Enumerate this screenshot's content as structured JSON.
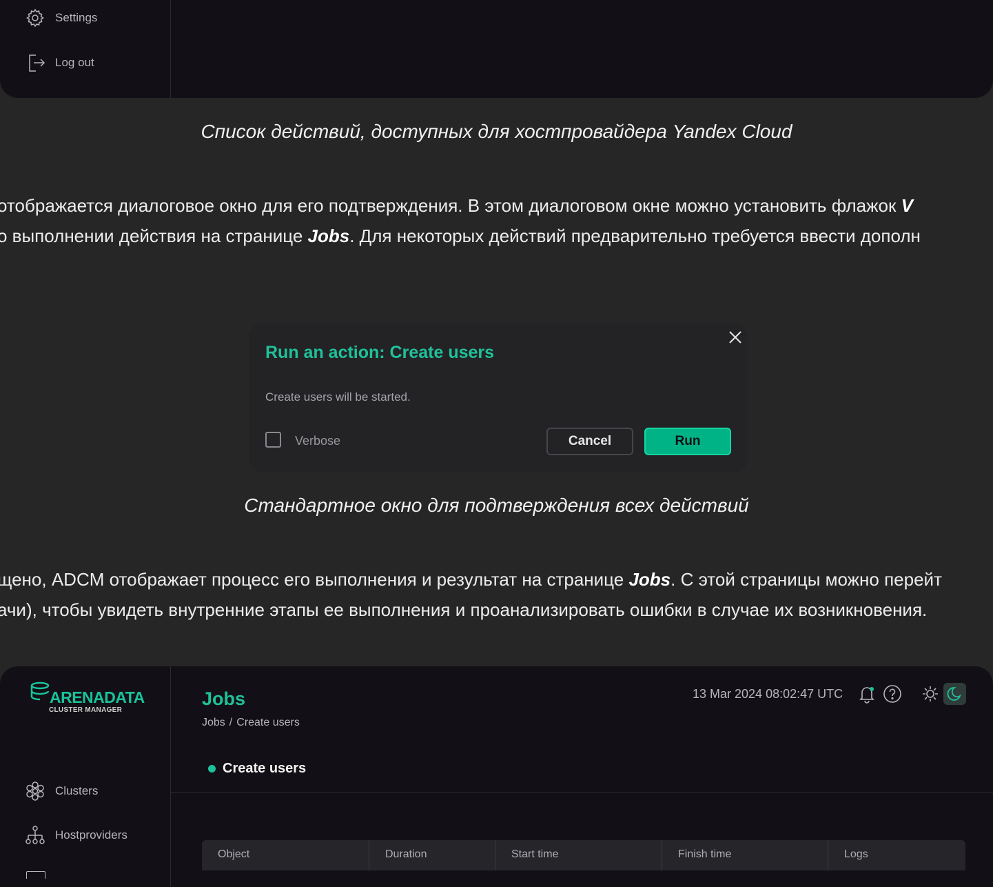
{
  "top_screenshot": {
    "nav": [
      {
        "label": "Settings",
        "icon": "gear-icon"
      },
      {
        "label": "Log out",
        "icon": "logout-icon"
      }
    ]
  },
  "caption1": "Список действий, доступных для хостпровайдера Yandex Cloud",
  "para1": {
    "line1_a": "отображается диалоговое окно для его подтверждения. В этом диалоговом окне можно установить флажок ",
    "line1_b": "V",
    "line2_a": "о выполнении действия на странице ",
    "line2_jobs": "Jobs",
    "line2_b": ". Для некоторых действий предварительно требуется ввести дополн"
  },
  "dialog": {
    "title": "Run an action: Create users",
    "message": "Create users will be started.",
    "verbose_label": "Verbose",
    "verbose_checked": false,
    "cancel_label": "Cancel",
    "run_label": "Run"
  },
  "caption2": "Стандартное окно для подтверждения всех действий",
  "para2": {
    "line1_a": "щено, ADCM отображает процесс его выполнения и результат на странице ",
    "line1_jobs": "Jobs",
    "line1_b": ". С этой страницы можно перейт",
    "line2": "ачи), чтобы увидеть внутренние этапы ее выполнения и проанализировать ошибки в случае их возникновения."
  },
  "bottom_screenshot": {
    "logo": {
      "name": "ARENADATA",
      "sub": "CLUSTER MANAGER"
    },
    "page_title": "Jobs",
    "breadcrumb": [
      "Jobs",
      "/",
      "Create users"
    ],
    "timestamp": "13 Mar 2024  08:02:47  UTC",
    "job": {
      "name": "Create users",
      "status_color": "#1fc19a"
    },
    "nav": [
      {
        "label": "Clusters",
        "icon": "clusters-icon"
      },
      {
        "label": "Hostproviders",
        "icon": "hostproviders-icon"
      }
    ],
    "table_columns": [
      "Object",
      "Duration",
      "Start time",
      "Finish time",
      "Logs"
    ]
  },
  "colors": {
    "accent": "#1fc19a",
    "run_button": "#00b386",
    "background": "#262626",
    "panel": "#121016"
  }
}
